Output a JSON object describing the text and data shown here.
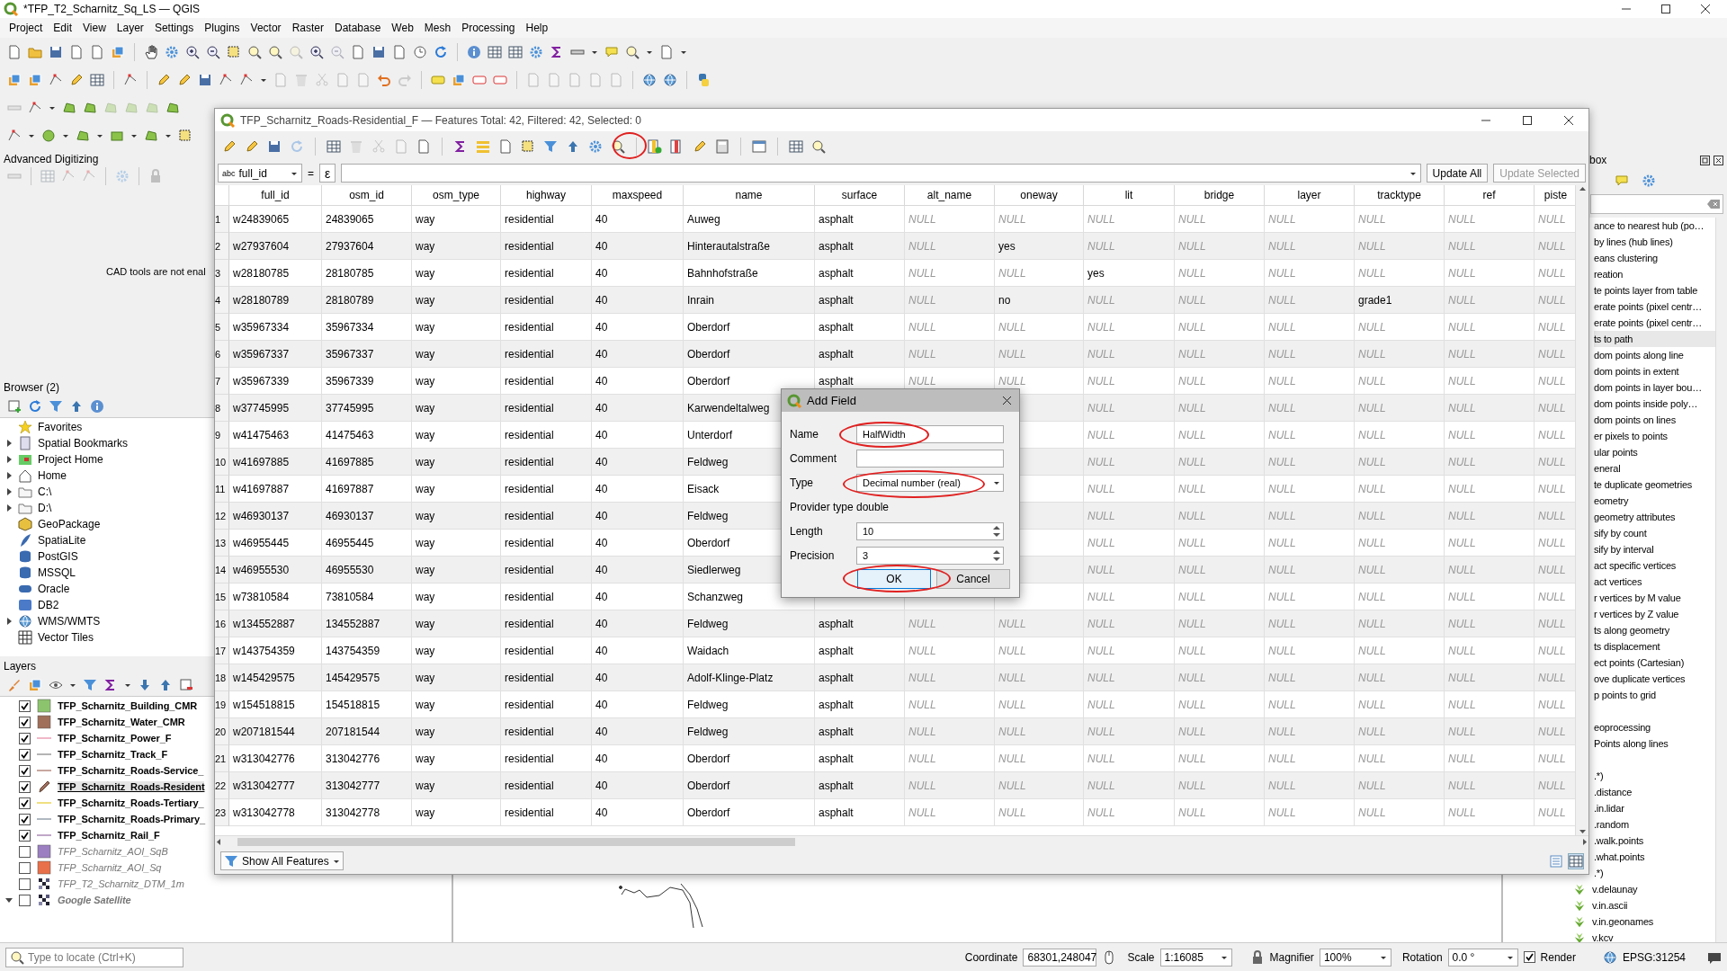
{
  "window": {
    "title": "*TFP_T2_Scharnitz_Sq_LS — QGIS"
  },
  "menu": [
    "Project",
    "Edit",
    "View",
    "Layer",
    "Settings",
    "Plugins",
    "Vector",
    "Raster",
    "Database",
    "Web",
    "Mesh",
    "Processing",
    "Help"
  ],
  "advanced_digitizing": {
    "title": "Advanced Digitizing",
    "message": "CAD tools are not enal"
  },
  "browser": {
    "title": "Browser (2)",
    "items": [
      {
        "label": "Favorites"
      },
      {
        "label": "Spatial Bookmarks",
        "has_children": true
      },
      {
        "label": "Project Home",
        "has_children": true
      },
      {
        "label": "Home",
        "has_children": true
      },
      {
        "label": "C:\\",
        "has_children": true
      },
      {
        "label": "D:\\",
        "has_children": true
      },
      {
        "label": "GeoPackage"
      },
      {
        "label": "SpatiaLite"
      },
      {
        "label": "PostGIS"
      },
      {
        "label": "MSSQL"
      },
      {
        "label": "Oracle"
      },
      {
        "label": "DB2"
      },
      {
        "label": "WMS/WMTS",
        "has_children": true
      },
      {
        "label": "Vector Tiles"
      }
    ]
  },
  "layers": {
    "title": "Layers",
    "items": [
      {
        "name": "TFP_Scharnitz_Building_CMR",
        "visible": true,
        "bold": true,
        "kind": "fill",
        "color": "#8cc46e",
        "selected": false
      },
      {
        "name": "TFP_Scharnitz_Water_CMR",
        "visible": true,
        "bold": true,
        "kind": "fill",
        "color": "#a0705a",
        "selected": false
      },
      {
        "name": "TFP_Scharnitz_Power_F",
        "visible": true,
        "bold": true,
        "kind": "line",
        "color": "#f0b8c8",
        "selected": false
      },
      {
        "name": "TFP_Scharnitz_Track_F",
        "visible": true,
        "bold": true,
        "kind": "line",
        "color": "#b4b4b4",
        "selected": false
      },
      {
        "name": "TFP_Scharnitz_Roads-Service_",
        "visible": true,
        "bold": true,
        "kind": "line",
        "color": "#c8a8a0",
        "selected": false
      },
      {
        "name": "TFP_Scharnitz_Roads-Resident",
        "visible": true,
        "bold": true,
        "kind": "editing",
        "selected": true
      },
      {
        "name": "TFP_Scharnitz_Roads-Tertiary_",
        "visible": true,
        "bold": true,
        "kind": "line",
        "color": "#f0e080",
        "selected": false
      },
      {
        "name": "TFP_Scharnitz_Roads-Primary_",
        "visible": true,
        "bold": true,
        "kind": "line",
        "color": "#b0b8c0",
        "selected": false
      },
      {
        "name": "TFP_Scharnitz_Rail_F",
        "visible": true,
        "bold": true,
        "kind": "line",
        "color": "#c0a8c8",
        "selected": false
      },
      {
        "name": "TFP_Scharnitz_AOI_SqB",
        "visible": false,
        "bold": false,
        "kind": "fill",
        "color": "#9b7fc0",
        "selected": false
      },
      {
        "name": "TFP_Scharnitz_AOI_Sq",
        "visible": false,
        "bold": false,
        "kind": "fill",
        "color": "#e8704a",
        "selected": false
      },
      {
        "name": "TFP_T2_Scharnitz_DTM_1m",
        "visible": false,
        "bold": false,
        "kind": "raster",
        "selected": false
      },
      {
        "name": "Google Satellite",
        "visible": false,
        "bold": true,
        "kind": "raster",
        "selected": false,
        "expanded": true
      }
    ]
  },
  "toolbox": {
    "title": "box",
    "items": [
      {
        "kind": "tool",
        "text": "ance to nearest hub (po…",
        "selected": false
      },
      {
        "kind": "tool",
        "text": "by lines (hub lines)",
        "selected": false
      },
      {
        "kind": "tool",
        "text": "eans clustering",
        "selected": false
      },
      {
        "kind": "tool",
        "text": "reation",
        "selected": false
      },
      {
        "kind": "tool",
        "text": "te points layer from table",
        "selected": false
      },
      {
        "kind": "tool",
        "text": "erate points (pixel centr…",
        "selected": false
      },
      {
        "kind": "tool",
        "text": "erate points (pixel centr…",
        "selected": false
      },
      {
        "kind": "tool",
        "text": "ts to path",
        "selected": true
      },
      {
        "kind": "tool",
        "text": "dom points along line",
        "selected": false
      },
      {
        "kind": "tool",
        "text": "dom points in extent",
        "selected": false
      },
      {
        "kind": "tool",
        "text": "dom points in layer bou…",
        "selected": false
      },
      {
        "kind": "tool",
        "text": "dom points inside poly…",
        "selected": false
      },
      {
        "kind": "tool",
        "text": "dom points on lines",
        "selected": false
      },
      {
        "kind": "tool",
        "text": "er pixels to points",
        "selected": false
      },
      {
        "kind": "tool",
        "text": "ular points",
        "selected": false
      },
      {
        "kind": "tool",
        "text": "eneral",
        "selected": false
      },
      {
        "kind": "tool",
        "text": "te duplicate geometries",
        "selected": false
      },
      {
        "kind": "tool",
        "text": "eometry",
        "selected": false
      },
      {
        "kind": "tool",
        "text": "geometry attributes",
        "selected": false
      },
      {
        "kind": "tool",
        "text": "sify by count",
        "selected": false
      },
      {
        "kind": "tool",
        "text": "sify by interval",
        "selected": false
      },
      {
        "kind": "tool",
        "text": "act specific vertices",
        "selected": false
      },
      {
        "kind": "tool",
        "text": "act vertices",
        "selected": false
      },
      {
        "kind": "tool",
        "text": "r vertices by M value",
        "selected": false
      },
      {
        "kind": "tool",
        "text": "r vertices by Z value",
        "selected": false
      },
      {
        "kind": "tool",
        "text": "ts along geometry",
        "selected": false
      },
      {
        "kind": "tool",
        "text": "ts displacement",
        "selected": false
      },
      {
        "kind": "tool",
        "text": "ect points (Cartesian)",
        "selected": false
      },
      {
        "kind": "tool",
        "text": "ove duplicate vertices",
        "selected": false
      },
      {
        "kind": "tool",
        "text": "p points to grid",
        "selected": false
      },
      {
        "kind": "blank"
      },
      {
        "kind": "tool",
        "text": "eoprocessing",
        "selected": false
      },
      {
        "kind": "tool",
        "text": "Points along lines",
        "selected": false
      },
      {
        "kind": "blank"
      },
      {
        "kind": "tool",
        "text": ".*)",
        "selected": false
      },
      {
        "kind": "tool",
        "text": ".distance",
        "selected": false
      },
      {
        "kind": "tool",
        "text": ".in.lidar",
        "selected": false
      },
      {
        "kind": "tool",
        "text": ".random",
        "selected": false
      },
      {
        "kind": "tool",
        "text": ".walk.points",
        "selected": false
      },
      {
        "kind": "tool",
        "text": ".what.points",
        "selected": false
      },
      {
        "kind": "tool",
        "text": ".*)",
        "selected": false
      },
      {
        "kind": "grass",
        "text": "v.delaunay",
        "selected": false
      },
      {
        "kind": "grass",
        "text": "v.in.ascii",
        "selected": false
      },
      {
        "kind": "grass",
        "text": "v.in.geonames",
        "selected": false
      },
      {
        "kind": "grass",
        "text": "v.kcv",
        "selected": false
      }
    ]
  },
  "attribute_table": {
    "title": "TFP_Scharnitz_Roads-Residential_F — Features Total: 42, Filtered: 42, Selected: 0",
    "add_field_tool_circled": true,
    "filter": {
      "type_label": "abc",
      "field": "full_id",
      "operator": "=",
      "expression_button": "ε",
      "update_all": {
        "label": "Update All",
        "disabled": false
      },
      "update_selected": {
        "label": "Update Selected",
        "disabled": true
      }
    },
    "columns": [
      "full_id",
      "osm_id",
      "osm_type",
      "highway",
      "maxspeed",
      "name",
      "surface",
      "alt_name",
      "oneway",
      "lit",
      "bridge",
      "layer",
      "tracktype",
      "ref",
      "piste"
    ],
    "rows": [
      {
        "number": "1",
        "cells": [
          "w24839065",
          "24839065",
          "way",
          "residential",
          "40",
          "Auweg",
          "asphalt",
          {
            "kind": "null",
            "text": "NULL"
          },
          {
            "kind": "null",
            "text": "NULL"
          },
          {
            "kind": "null",
            "text": "NULL"
          },
          {
            "kind": "null",
            "text": "NULL"
          },
          {
            "kind": "null",
            "text": "NULL"
          },
          {
            "kind": "null",
            "text": "NULL"
          },
          {
            "kind": "null",
            "text": "NULL"
          },
          {
            "kind": "null",
            "text": "NULL"
          }
        ]
      },
      {
        "number": "2",
        "cells": [
          "w27937604",
          "27937604",
          "way",
          "residential",
          "40",
          "Hinterautalstraße",
          "asphalt",
          {
            "kind": "null",
            "text": "NULL"
          },
          "yes",
          {
            "kind": "null",
            "text": "NULL"
          },
          {
            "kind": "null",
            "text": "NULL"
          },
          {
            "kind": "null",
            "text": "NULL"
          },
          {
            "kind": "null",
            "text": "NULL"
          },
          {
            "kind": "null",
            "text": "NULL"
          },
          {
            "kind": "null",
            "text": "NULL"
          }
        ]
      },
      {
        "number": "3",
        "cells": [
          "w28180785",
          "28180785",
          "way",
          "residential",
          "40",
          "Bahnhofstraße",
          "asphalt",
          {
            "kind": "null",
            "text": "NULL"
          },
          {
            "kind": "null",
            "text": "NULL"
          },
          "yes",
          {
            "kind": "null",
            "text": "NULL"
          },
          {
            "kind": "null",
            "text": "NULL"
          },
          {
            "kind": "null",
            "text": "NULL"
          },
          {
            "kind": "null",
            "text": "NULL"
          },
          {
            "kind": "null",
            "text": "NULL"
          }
        ]
      },
      {
        "number": "4",
        "cells": [
          "w28180789",
          "28180789",
          "way",
          "residential",
          "40",
          "Inrain",
          "asphalt",
          {
            "kind": "null",
            "text": "NULL"
          },
          "no",
          {
            "kind": "null",
            "text": "NULL"
          },
          {
            "kind": "null",
            "text": "NULL"
          },
          {
            "kind": "null",
            "text": "NULL"
          },
          "grade1",
          {
            "kind": "null",
            "text": "NULL"
          },
          {
            "kind": "null",
            "text": "NULL"
          }
        ]
      },
      {
        "number": "5",
        "cells": [
          "w35967334",
          "35967334",
          "way",
          "residential",
          "40",
          "Oberdorf",
          "asphalt",
          {
            "kind": "null",
            "text": "NULL"
          },
          {
            "kind": "null",
            "text": "NULL"
          },
          {
            "kind": "null",
            "text": "NULL"
          },
          {
            "kind": "null",
            "text": "NULL"
          },
          {
            "kind": "null",
            "text": "NULL"
          },
          {
            "kind": "null",
            "text": "NULL"
          },
          {
            "kind": "null",
            "text": "NULL"
          },
          {
            "kind": "null",
            "text": "NULL"
          }
        ]
      },
      {
        "number": "6",
        "cells": [
          "w35967337",
          "35967337",
          "way",
          "residential",
          "40",
          "Oberdorf",
          "asphalt",
          {
            "kind": "null",
            "text": "NULL"
          },
          {
            "kind": "null",
            "text": "NULL"
          },
          {
            "kind": "null",
            "text": "NULL"
          },
          {
            "kind": "null",
            "text": "NULL"
          },
          {
            "kind": "null",
            "text": "NULL"
          },
          {
            "kind": "null",
            "text": "NULL"
          },
          {
            "kind": "null",
            "text": "NULL"
          },
          {
            "kind": "null",
            "text": "NULL"
          }
        ]
      },
      {
        "number": "7",
        "cells": [
          "w35967339",
          "35967339",
          "way",
          "residential",
          "40",
          "Oberdorf",
          "asphalt",
          {
            "kind": "null",
            "text": "NULL"
          },
          {
            "kind": "null",
            "text": "NULL"
          },
          {
            "kind": "null",
            "text": "NULL"
          },
          {
            "kind": "null",
            "text": "NULL"
          },
          {
            "kind": "null",
            "text": "NULL"
          },
          {
            "kind": "null",
            "text": "NULL"
          },
          {
            "kind": "null",
            "text": "NULL"
          },
          {
            "kind": "null",
            "text": "NULL"
          }
        ]
      },
      {
        "number": "8",
        "cells": [
          "w37745995",
          "37745995",
          "way",
          "residential",
          "40",
          "Karwendeltalweg",
          null,
          null,
          null,
          {
            "kind": "null",
            "text": "NULL"
          },
          {
            "kind": "null",
            "text": "NULL"
          },
          {
            "kind": "null",
            "text": "NULL"
          },
          {
            "kind": "null",
            "text": "NULL"
          },
          {
            "kind": "null",
            "text": "NULL"
          },
          {
            "kind": "null",
            "text": "NULL"
          }
        ]
      },
      {
        "number": "9",
        "cells": [
          "w41475463",
          "41475463",
          "way",
          "residential",
          "40",
          "Unterdorf",
          null,
          null,
          null,
          {
            "kind": "null",
            "text": "NULL"
          },
          {
            "kind": "null",
            "text": "NULL"
          },
          {
            "kind": "null",
            "text": "NULL"
          },
          {
            "kind": "null",
            "text": "NULL"
          },
          {
            "kind": "null",
            "text": "NULL"
          },
          {
            "kind": "null",
            "text": "NULL"
          }
        ]
      },
      {
        "number": "10",
        "cells": [
          "w41697885",
          "41697885",
          "way",
          "residential",
          "40",
          "Feldweg",
          null,
          null,
          null,
          {
            "kind": "null",
            "text": "NULL"
          },
          {
            "kind": "null",
            "text": "NULL"
          },
          {
            "kind": "null",
            "text": "NULL"
          },
          {
            "kind": "null",
            "text": "NULL"
          },
          {
            "kind": "null",
            "text": "NULL"
          },
          {
            "kind": "null",
            "text": "NULL"
          }
        ]
      },
      {
        "number": "11",
        "cells": [
          "w41697887",
          "41697887",
          "way",
          "residential",
          "40",
          "Eisack",
          null,
          null,
          null,
          {
            "kind": "null",
            "text": "NULL"
          },
          {
            "kind": "null",
            "text": "NULL"
          },
          {
            "kind": "null",
            "text": "NULL"
          },
          {
            "kind": "null",
            "text": "NULL"
          },
          {
            "kind": "null",
            "text": "NULL"
          },
          {
            "kind": "null",
            "text": "NULL"
          }
        ]
      },
      {
        "number": "12",
        "cells": [
          "w46930137",
          "46930137",
          "way",
          "residential",
          "40",
          "Feldweg",
          null,
          null,
          null,
          {
            "kind": "null",
            "text": "NULL"
          },
          {
            "kind": "null",
            "text": "NULL"
          },
          {
            "kind": "null",
            "text": "NULL"
          },
          {
            "kind": "null",
            "text": "NULL"
          },
          {
            "kind": "null",
            "text": "NULL"
          },
          {
            "kind": "null",
            "text": "NULL"
          }
        ]
      },
      {
        "number": "13",
        "cells": [
          "w46955445",
          "46955445",
          "way",
          "residential",
          "40",
          "Oberdorf",
          null,
          null,
          null,
          {
            "kind": "null",
            "text": "NULL"
          },
          {
            "kind": "null",
            "text": "NULL"
          },
          {
            "kind": "null",
            "text": "NULL"
          },
          {
            "kind": "null",
            "text": "NULL"
          },
          {
            "kind": "null",
            "text": "NULL"
          },
          {
            "kind": "null",
            "text": "NULL"
          }
        ]
      },
      {
        "number": "14",
        "cells": [
          "w46955530",
          "46955530",
          "way",
          "residential",
          "40",
          "Siedlerweg",
          null,
          null,
          null,
          {
            "kind": "null",
            "text": "NULL"
          },
          {
            "kind": "null",
            "text": "NULL"
          },
          {
            "kind": "null",
            "text": "NULL"
          },
          {
            "kind": "null",
            "text": "NULL"
          },
          {
            "kind": "null",
            "text": "NULL"
          },
          {
            "kind": "null",
            "text": "NULL"
          }
        ]
      },
      {
        "number": "15",
        "cells": [
          "w73810584",
          "73810584",
          "way",
          "residential",
          "40",
          "Schanzweg",
          null,
          null,
          null,
          {
            "kind": "null",
            "text": "NULL"
          },
          {
            "kind": "null",
            "text": "NULL"
          },
          {
            "kind": "null",
            "text": "NULL"
          },
          {
            "kind": "null",
            "text": "NULL"
          },
          {
            "kind": "null",
            "text": "NULL"
          },
          {
            "kind": "null",
            "text": "NULL"
          }
        ]
      },
      {
        "number": "16",
        "cells": [
          "w134552887",
          "134552887",
          "way",
          "residential",
          "40",
          "Feldweg",
          "asphalt",
          {
            "kind": "null",
            "text": "NULL"
          },
          {
            "kind": "null",
            "text": "NULL"
          },
          {
            "kind": "null",
            "text": "NULL"
          },
          {
            "kind": "null",
            "text": "NULL"
          },
          {
            "kind": "null",
            "text": "NULL"
          },
          {
            "kind": "null",
            "text": "NULL"
          },
          {
            "kind": "null",
            "text": "NULL"
          },
          {
            "kind": "null",
            "text": "NULL"
          }
        ]
      },
      {
        "number": "17",
        "cells": [
          "w143754359",
          "143754359",
          "way",
          "residential",
          "40",
          "Waidach",
          "asphalt",
          {
            "kind": "null",
            "text": "NULL"
          },
          {
            "kind": "null",
            "text": "NULL"
          },
          {
            "kind": "null",
            "text": "NULL"
          },
          {
            "kind": "null",
            "text": "NULL"
          },
          {
            "kind": "null",
            "text": "NULL"
          },
          {
            "kind": "null",
            "text": "NULL"
          },
          {
            "kind": "null",
            "text": "NULL"
          },
          {
            "kind": "null",
            "text": "NULL"
          }
        ]
      },
      {
        "number": "18",
        "cells": [
          "w145429575",
          "145429575",
          "way",
          "residential",
          "40",
          "Adolf-Klinge-Platz",
          "asphalt",
          {
            "kind": "null",
            "text": "NULL"
          },
          {
            "kind": "null",
            "text": "NULL"
          },
          {
            "kind": "null",
            "text": "NULL"
          },
          {
            "kind": "null",
            "text": "NULL"
          },
          {
            "kind": "null",
            "text": "NULL"
          },
          {
            "kind": "null",
            "text": "NULL"
          },
          {
            "kind": "null",
            "text": "NULL"
          },
          {
            "kind": "null",
            "text": "NULL"
          }
        ]
      },
      {
        "number": "19",
        "cells": [
          "w154518815",
          "154518815",
          "way",
          "residential",
          "40",
          "Feldweg",
          "asphalt",
          {
            "kind": "null",
            "text": "NULL"
          },
          {
            "kind": "null",
            "text": "NULL"
          },
          {
            "kind": "null",
            "text": "NULL"
          },
          {
            "kind": "null",
            "text": "NULL"
          },
          {
            "kind": "null",
            "text": "NULL"
          },
          {
            "kind": "null",
            "text": "NULL"
          },
          {
            "kind": "null",
            "text": "NULL"
          },
          {
            "kind": "null",
            "text": "NULL"
          }
        ]
      },
      {
        "number": "20",
        "cells": [
          "w207181544",
          "207181544",
          "way",
          "residential",
          "40",
          "Feldweg",
          "asphalt",
          {
            "kind": "null",
            "text": "NULL"
          },
          {
            "kind": "null",
            "text": "NULL"
          },
          {
            "kind": "null",
            "text": "NULL"
          },
          {
            "kind": "null",
            "text": "NULL"
          },
          {
            "kind": "null",
            "text": "NULL"
          },
          {
            "kind": "null",
            "text": "NULL"
          },
          {
            "kind": "null",
            "text": "NULL"
          },
          {
            "kind": "null",
            "text": "NULL"
          }
        ]
      },
      {
        "number": "21",
        "cells": [
          "w313042776",
          "313042776",
          "way",
          "residential",
          "40",
          "Oberdorf",
          "asphalt",
          {
            "kind": "null",
            "text": "NULL"
          },
          {
            "kind": "null",
            "text": "NULL"
          },
          {
            "kind": "null",
            "text": "NULL"
          },
          {
            "kind": "null",
            "text": "NULL"
          },
          {
            "kind": "null",
            "text": "NULL"
          },
          {
            "kind": "null",
            "text": "NULL"
          },
          {
            "kind": "null",
            "text": "NULL"
          },
          {
            "kind": "null",
            "text": "NULL"
          }
        ]
      },
      {
        "number": "22",
        "cells": [
          "w313042777",
          "313042777",
          "way",
          "residential",
          "40",
          "Oberdorf",
          "asphalt",
          {
            "kind": "null",
            "text": "NULL"
          },
          {
            "kind": "null",
            "text": "NULL"
          },
          {
            "kind": "null",
            "text": "NULL"
          },
          {
            "kind": "null",
            "text": "NULL"
          },
          {
            "kind": "null",
            "text": "NULL"
          },
          {
            "kind": "null",
            "text": "NULL"
          },
          {
            "kind": "null",
            "text": "NULL"
          },
          {
            "kind": "null",
            "text": "NULL"
          }
        ]
      },
      {
        "number": "23",
        "cells": [
          "w313042778",
          "313042778",
          "way",
          "residential",
          "40",
          "Oberdorf",
          "asphalt",
          {
            "kind": "null",
            "text": "NULL"
          },
          {
            "kind": "null",
            "text": "NULL"
          },
          {
            "kind": "null",
            "text": "NULL"
          },
          {
            "kind": "null",
            "text": "NULL"
          },
          {
            "kind": "null",
            "text": "NULL"
          },
          {
            "kind": "null",
            "text": "NULL"
          },
          {
            "kind": "null",
            "text": "NULL"
          },
          {
            "kind": "null",
            "text": "NULL"
          }
        ]
      }
    ],
    "show_all_button": "Show All Features"
  },
  "add_field_dialog": {
    "title": "Add Field",
    "fields": [
      {
        "label": "Name",
        "kind": "text",
        "value": "HalfWidth",
        "circled": true
      },
      {
        "label": "Comment",
        "kind": "text"
      },
      {
        "label": "Type",
        "kind": "combo",
        "value": "Decimal number (real)",
        "circled": true
      },
      {
        "label": "Provider type",
        "kind": "info",
        "value": "double"
      },
      {
        "label": "Length",
        "kind": "spin",
        "value": "10"
      },
      {
        "label": "Precision",
        "kind": "spin",
        "value": "3"
      }
    ],
    "buttons": [
      {
        "label": "OK",
        "default": true,
        "circled": true
      },
      {
        "label": "Cancel",
        "default": false,
        "circled": false
      }
    ]
  },
  "status_bar": {
    "locate_placeholder": "Type to locate (Ctrl+K)",
    "coordinate_label": "Coordinate",
    "coordinate": "68301,248047",
    "scale_label": "Scale",
    "scale": "1:16085",
    "magnifier_label": "Magnifier",
    "magnifier": "100%",
    "rotation_label": "Rotation",
    "rotation": "0.0 °",
    "render_label": "Render",
    "render": true,
    "crs": "EPSG:31254"
  }
}
